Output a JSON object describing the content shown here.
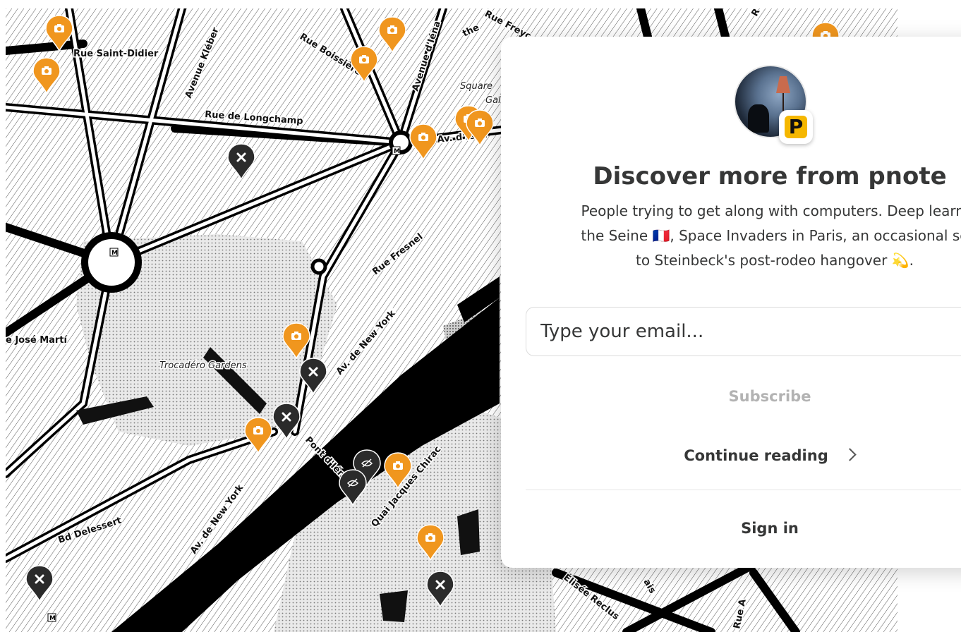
{
  "map": {
    "street_labels": [
      "Rue Saint-Didier",
      "Avenue Kléber",
      "Rue Boissière",
      "Avenue d'Iéna",
      "Rue Freyc",
      "Rue de Longchamp",
      "Av. d'Iéna",
      "Rue Fresnel",
      "Av. de New York",
      "Pont d'Iéna",
      "Quai Jacques Chirac",
      "Bd Delessert",
      "Av. de New York",
      "e José Martí",
      "Square",
      "Gal",
      "the",
      "R",
      "Élisée Reclus",
      "Rue A",
      "ais"
    ],
    "place_labels": [
      "Trocadéro Gardens"
    ],
    "metro_badge": "M",
    "marker_types": {
      "photo": "camera-icon",
      "removed": "close-icon",
      "hidden": "eye-slash-icon"
    },
    "colors": {
      "photo_marker": "#f0961e",
      "removed_marker": "#2b2b2b"
    }
  },
  "overlay": {
    "avatar_badge": "P",
    "title": "Discover more from pnote",
    "description_lines": [
      "People trying to get along with computers. Deep learni",
      "the Seine 🇫🇷, Space Invaders in Paris, an occasional se",
      "to Steinbeck's post-rodeo hangover 💫."
    ],
    "email_placeholder": "Type your email...",
    "subscribe_label": "Subscribe",
    "continue_label": "Continue reading",
    "signin_label": "Sign in",
    "colors": {
      "brand_badge": "#f5b700",
      "text": "#363737",
      "disabled_text": "#b3b3b3"
    }
  }
}
